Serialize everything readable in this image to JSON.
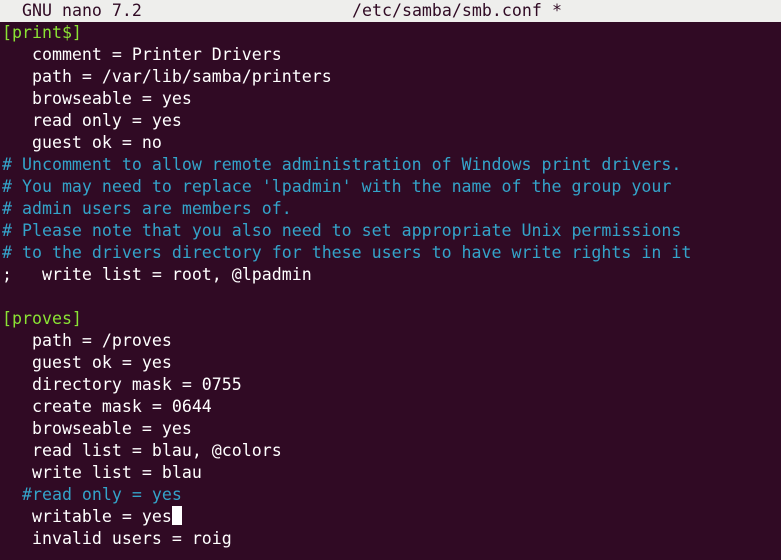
{
  "titlebar": {
    "app": "GNU nano 7.2",
    "file": "/etc/samba/smb.conf",
    "modified": "*"
  },
  "editor": {
    "lines": [
      "[print$]",
      "   comment = Printer Drivers",
      "   path = /var/lib/samba/printers",
      "   browseable = yes",
      "   read only = yes",
      "   guest ok = no",
      "# Uncomment to allow remote administration of Windows print drivers.",
      "# You may need to replace 'lpadmin' with the name of the group your",
      "# admin users are members of.",
      "# Please note that you also need to set appropriate Unix permissions",
      "# to the drivers directory for these users to have write rights in it",
      ";   write list = root, @lpadmin",
      "",
      "[proves]",
      "   path = /proves",
      "   guest ok = yes",
      "   directory mask = 0755",
      "   create mask = 0644",
      "   browseable = yes",
      "   read list = blau, @colors",
      "   write list = blau",
      "  #read only = yes",
      "   writable = yes",
      "   invalid users = roig"
    ]
  },
  "colors": {
    "background": "#300a24",
    "titlebar_bg": "#eeeeec",
    "section": "#8ae234",
    "comment": "#34a3c9",
    "text": "#ffffff"
  }
}
